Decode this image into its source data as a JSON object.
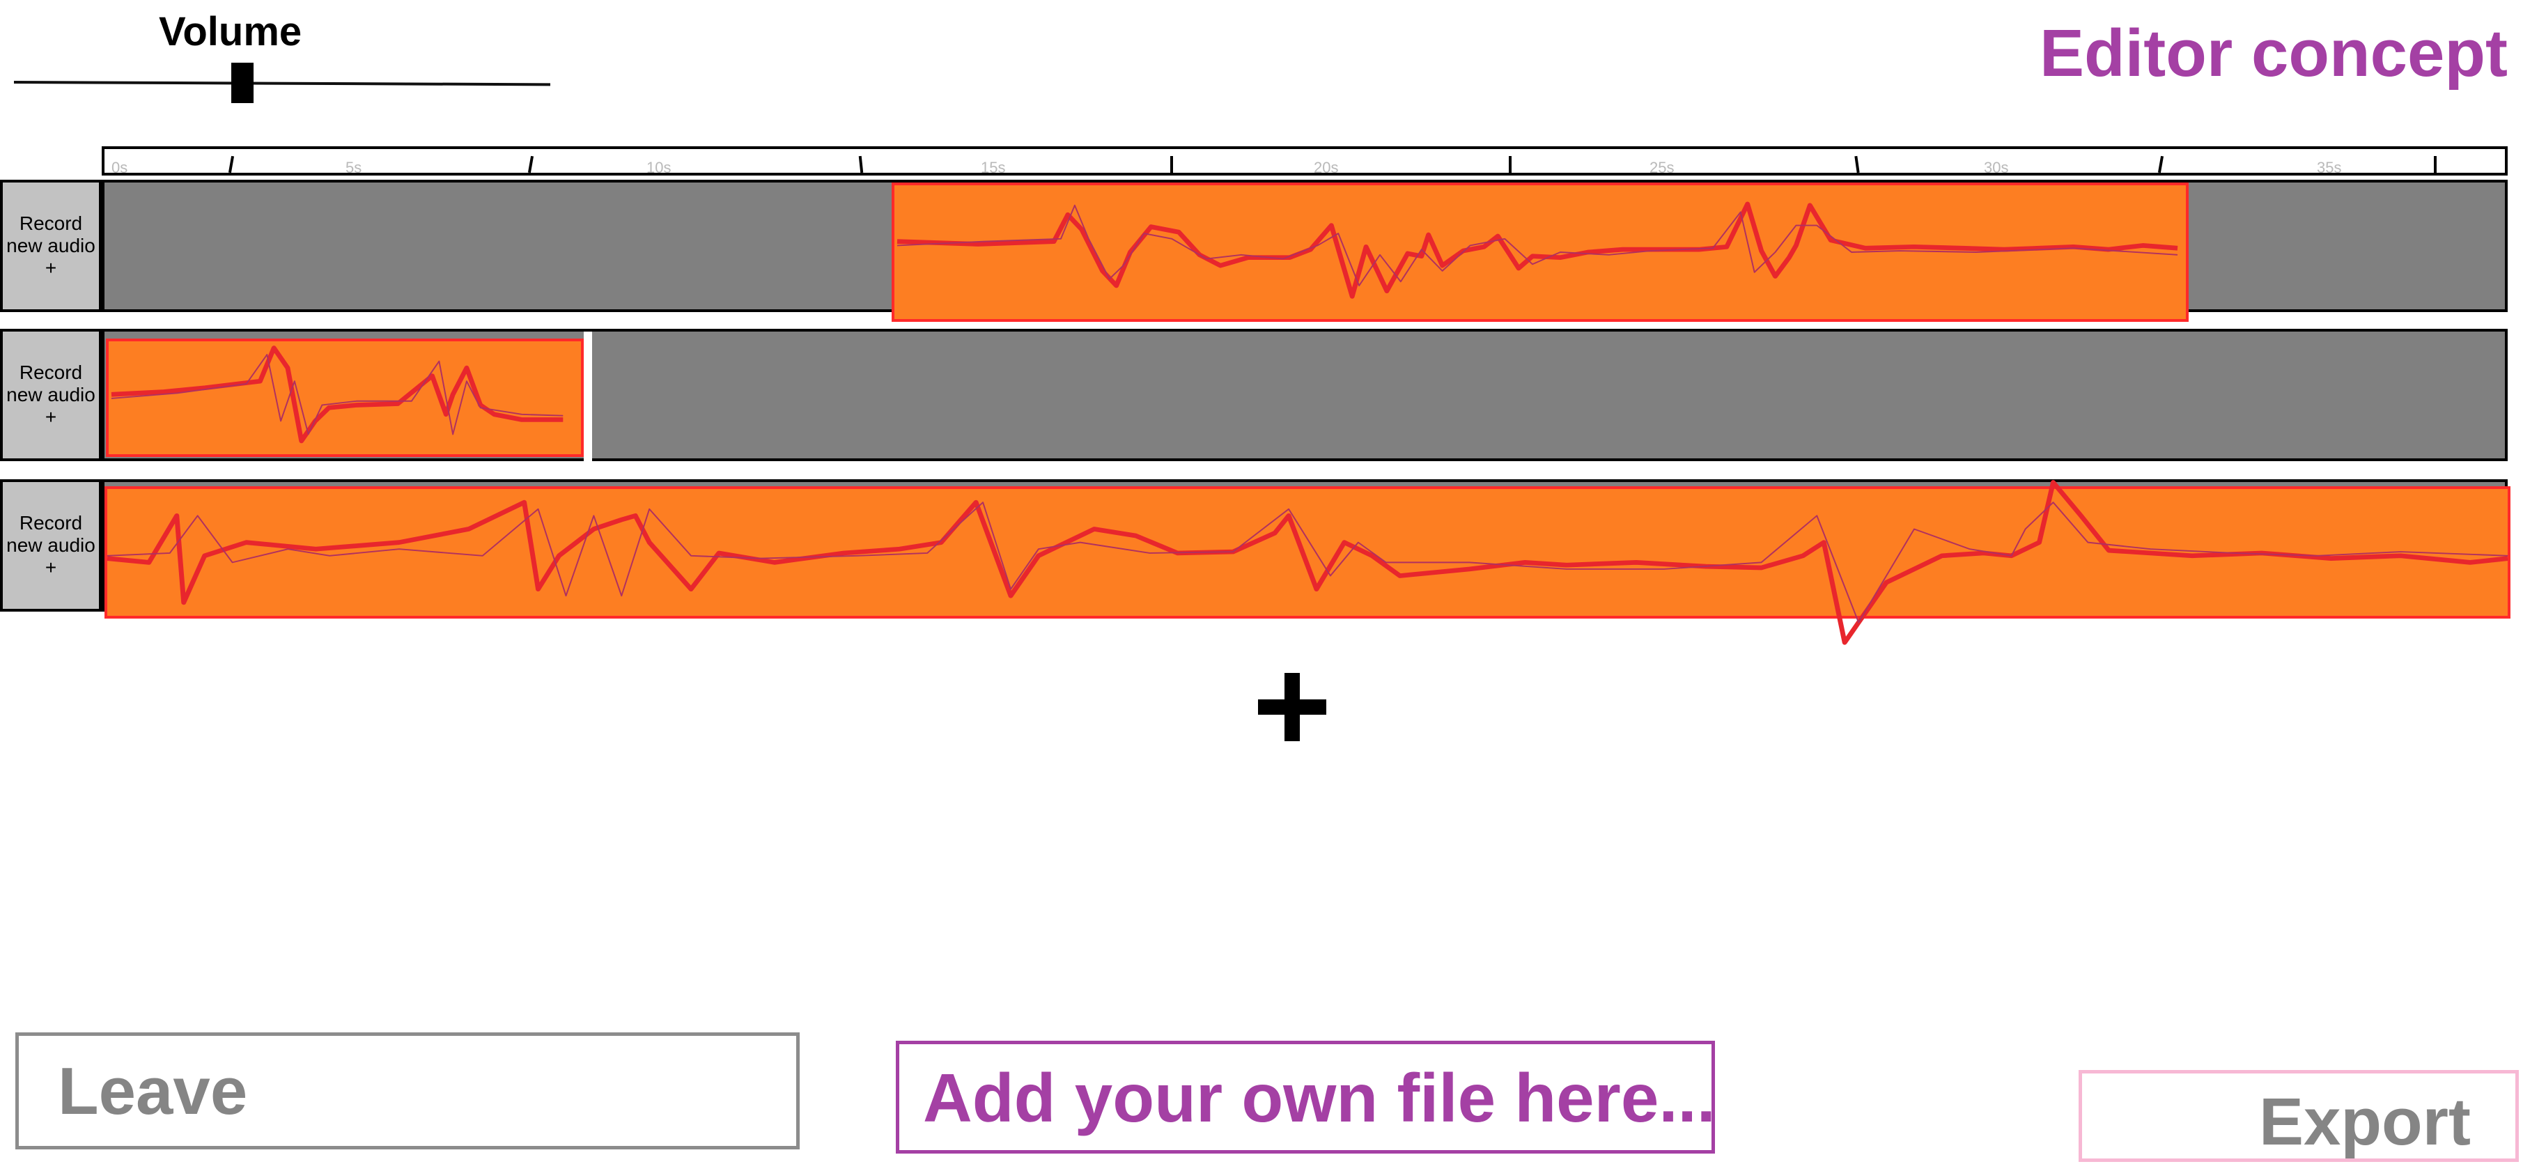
{
  "title": "Editor concept",
  "volume": {
    "label": "Volume",
    "level": 0.43
  },
  "ruler": {
    "labels": [
      "0s",
      "5s",
      "10s",
      "15s",
      "20s",
      "25s",
      "30s",
      "35s"
    ]
  },
  "tracks": [
    {
      "record_label_line1": "Record",
      "record_label_line2": "new audio",
      "record_label_line3": "+"
    },
    {
      "record_label_line1": "Record",
      "record_label_line2": "new audio",
      "record_label_line3": "+"
    },
    {
      "record_label_line1": "Record",
      "record_label_line2": "new audio",
      "record_label_line3": "+"
    }
  ],
  "add_track_symbol": "+",
  "buttons": {
    "leave": "Leave",
    "add_file": "Add your own file here...",
    "export": "Export"
  },
  "colors": {
    "accent": "#a440a4",
    "clip_fill": "#fd7e22",
    "waveform": "#e8262d",
    "lane_empty": "#808080"
  }
}
